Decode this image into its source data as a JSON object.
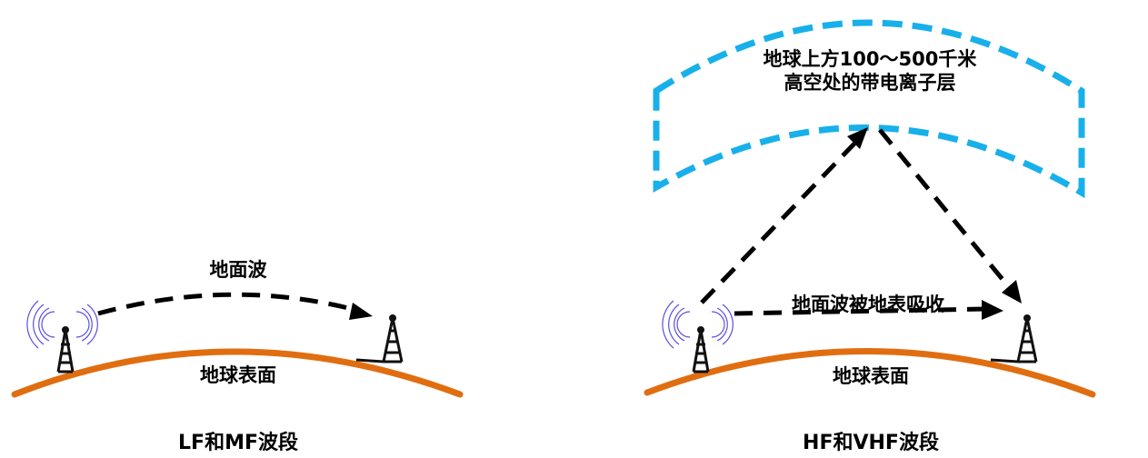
{
  "colors": {
    "earth": "#e06e10",
    "ionosphere": "#18b0ea",
    "arrow": "#000000",
    "signal": "#5a50e0",
    "tower": "#111111"
  },
  "left_panel": {
    "wave_label": "地面波",
    "surface_label": "地球表面",
    "band_label": "LF和MF波段"
  },
  "right_panel": {
    "ionosphere_line1": "地球上方100～500千米",
    "ionosphere_line2": "高空处的带电离子层",
    "wave_label": "地面波被地表吸收",
    "surface_label": "地球表面",
    "band_label": "HF和VHF波段"
  }
}
